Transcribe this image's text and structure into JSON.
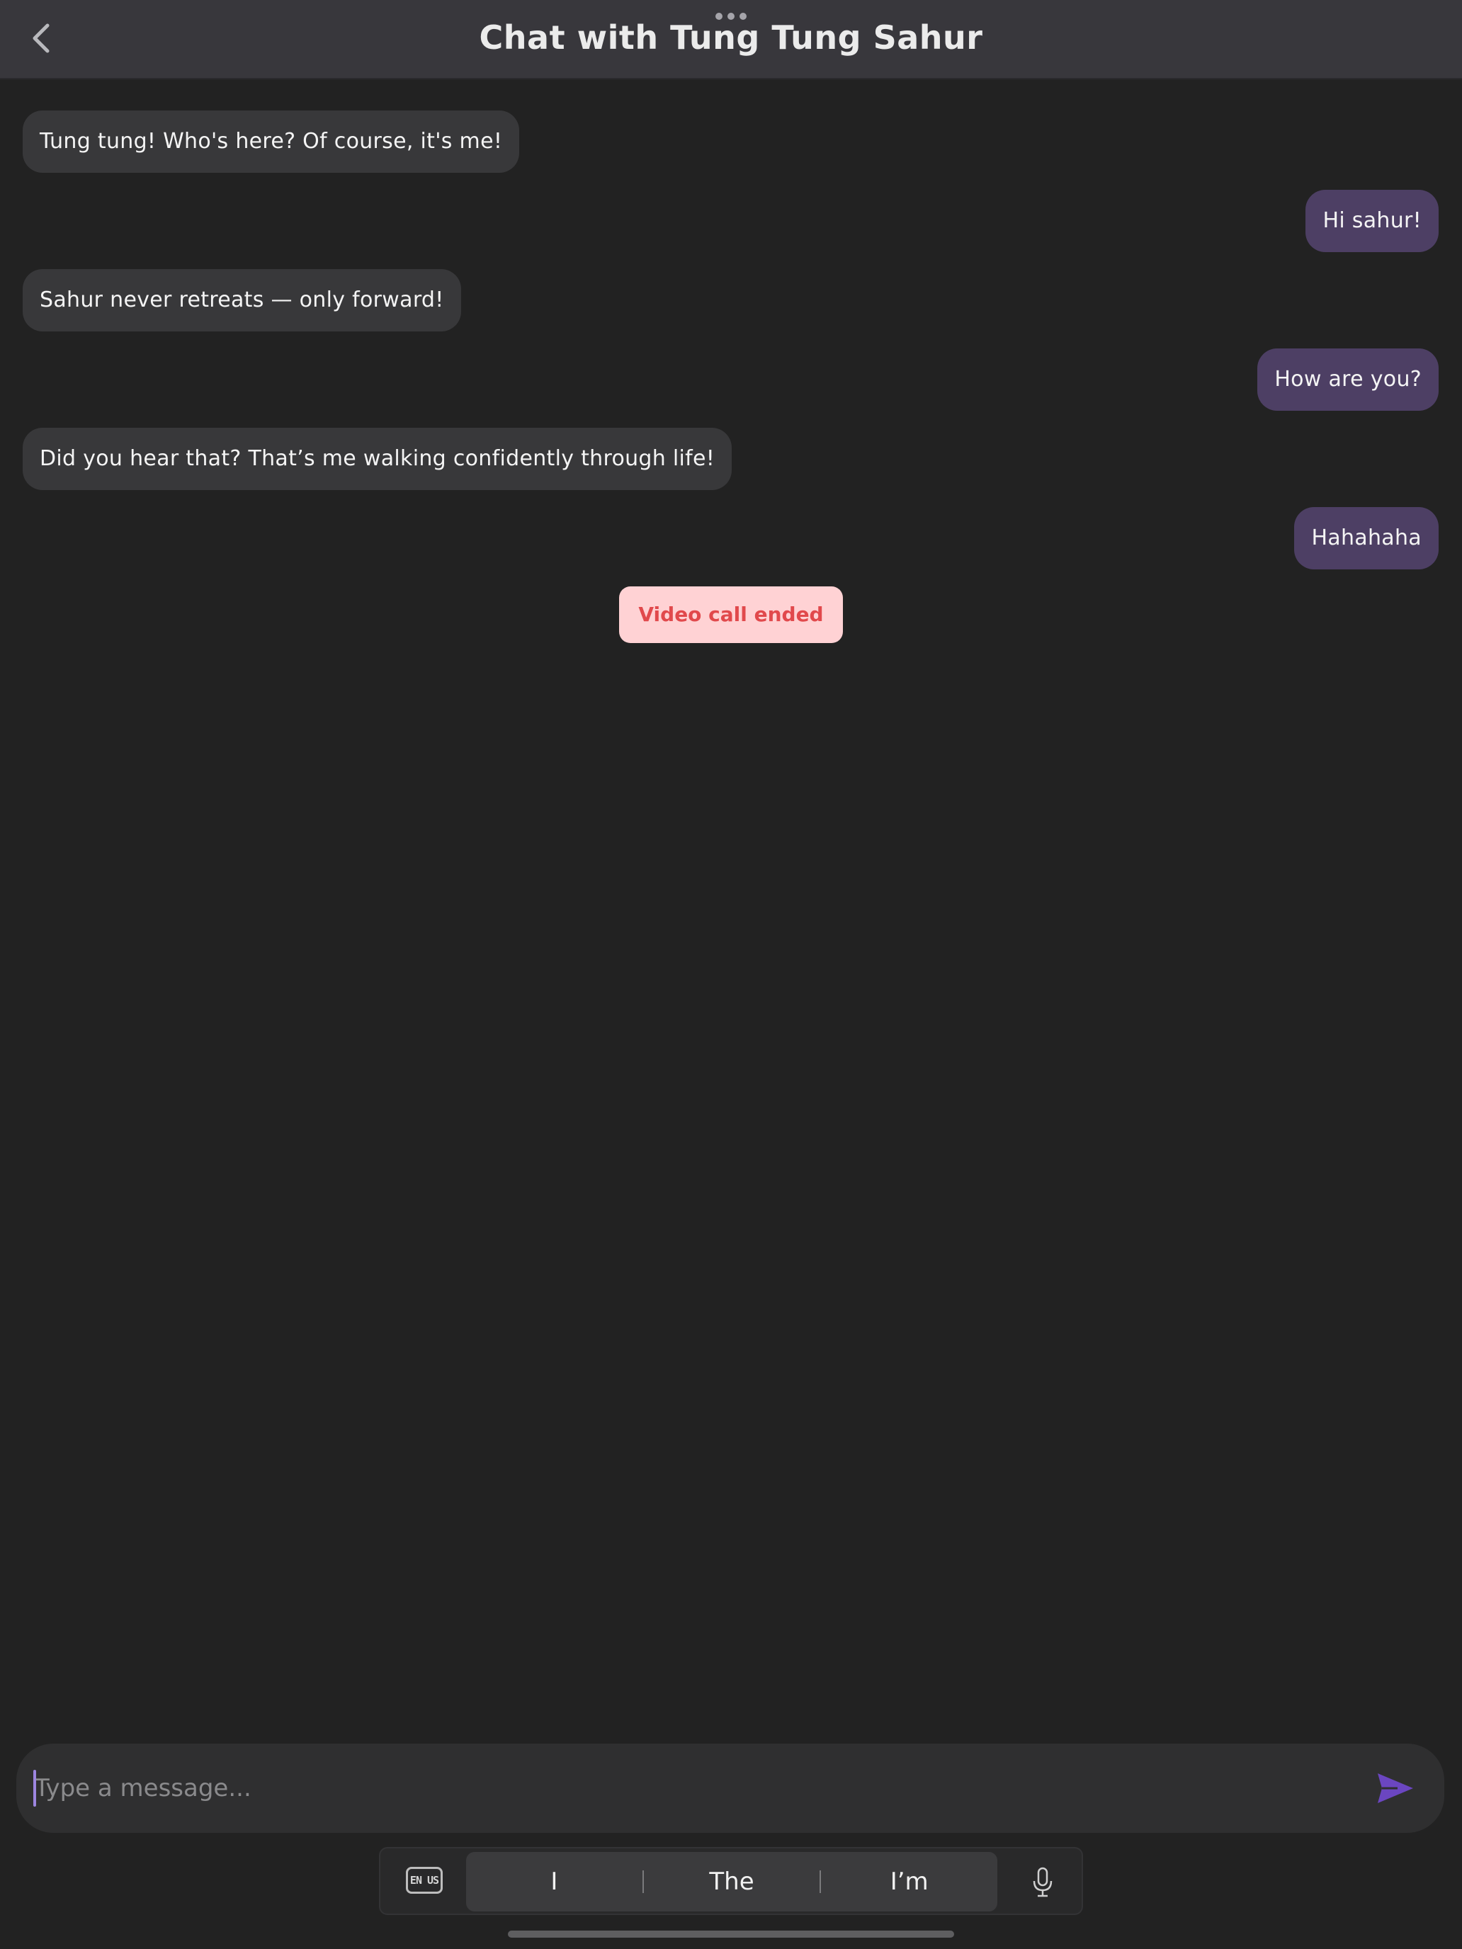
{
  "header": {
    "title": "Chat with Tung Tung Sahur",
    "back_icon": "chevron-left-icon",
    "menu_icon": "more-dots-icon"
  },
  "messages": [
    {
      "sender": "bot",
      "text": "Tung tung! Who's here? Of course, it's me!"
    },
    {
      "sender": "user",
      "text": "Hi sahur!"
    },
    {
      "sender": "bot",
      "text": "Sahur never retreats — only forward!"
    },
    {
      "sender": "user",
      "text": "How are you?"
    },
    {
      "sender": "bot",
      "text": "Did you hear that? That’s me walking confidently through life!"
    },
    {
      "sender": "user",
      "text": "Hahahaha"
    }
  ],
  "system_notice": {
    "text": "Video call ended"
  },
  "composer": {
    "value": "",
    "placeholder": "Type a message...",
    "send_icon": "send-icon"
  },
  "keyboard": {
    "language_label": "EN US",
    "suggestions": [
      "I",
      "The",
      "I’m"
    ],
    "mic_icon": "microphone-icon"
  },
  "colors": {
    "background": "#222222",
    "header": "#38373c",
    "incoming_bubble": "#38383a",
    "outgoing_bubble": "#4d3f64",
    "notice_bg": "#ffd2d4",
    "notice_text": "#e1494c",
    "accent": "#6b46c1"
  }
}
